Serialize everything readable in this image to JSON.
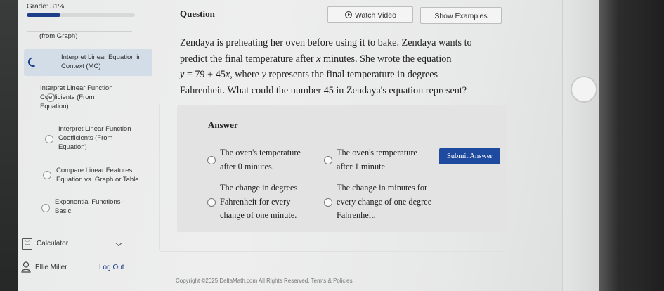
{
  "sidebar": {
    "grade": "Grade: 31%",
    "progress_fraction": 0.31,
    "items": [
      {
        "label": "(from Graph)"
      },
      {
        "label": "Interpret Linear Equation in Context (MC)"
      },
      {
        "label": "Interpret Linear Function Coefficients (From Equation)"
      },
      {
        "label": "Interpret Linear Function Coefficients (From Equation)"
      },
      {
        "label": "Compare Linear Features Equation vs. Graph or Table"
      },
      {
        "label": "Exponential Functions - Basic"
      }
    ],
    "calculator": "Calculator",
    "user_name": "Ellie Miller",
    "logout": "Log Out"
  },
  "header": {
    "question_label": "Question",
    "watch_video": "Watch Video",
    "show_examples": "Show Examples"
  },
  "question": {
    "line1": "Zendaya is preheating her oven before using it to bake. Zendaya wants to",
    "line2a": "predict the final temperature after ",
    "line2var": "x",
    "line2b": " minutes. She wrote the equation",
    "eq_y": "y",
    "eq_mid": " = 79 + 45",
    "eq_x": "x",
    "line3a": ", where ",
    "line3var": "y",
    "line3b": " represents the final temperature in degrees",
    "line4": "Fahrenheit. What could the number 45 in Zendaya's equation represent?"
  },
  "answer": {
    "label": "Answer",
    "choices": [
      "The oven's temperature after 0 minutes.",
      "The oven's temperature after 1 minute.",
      "The change in degrees Fahrenheit for every change of one minute.",
      "The change in minutes for every change of one degree Fahrenheit."
    ],
    "submit": "Submit Answer"
  },
  "footer": "Copyright ©2025 DeltaMath.com All Rights Reserved. Terms & Policies"
}
